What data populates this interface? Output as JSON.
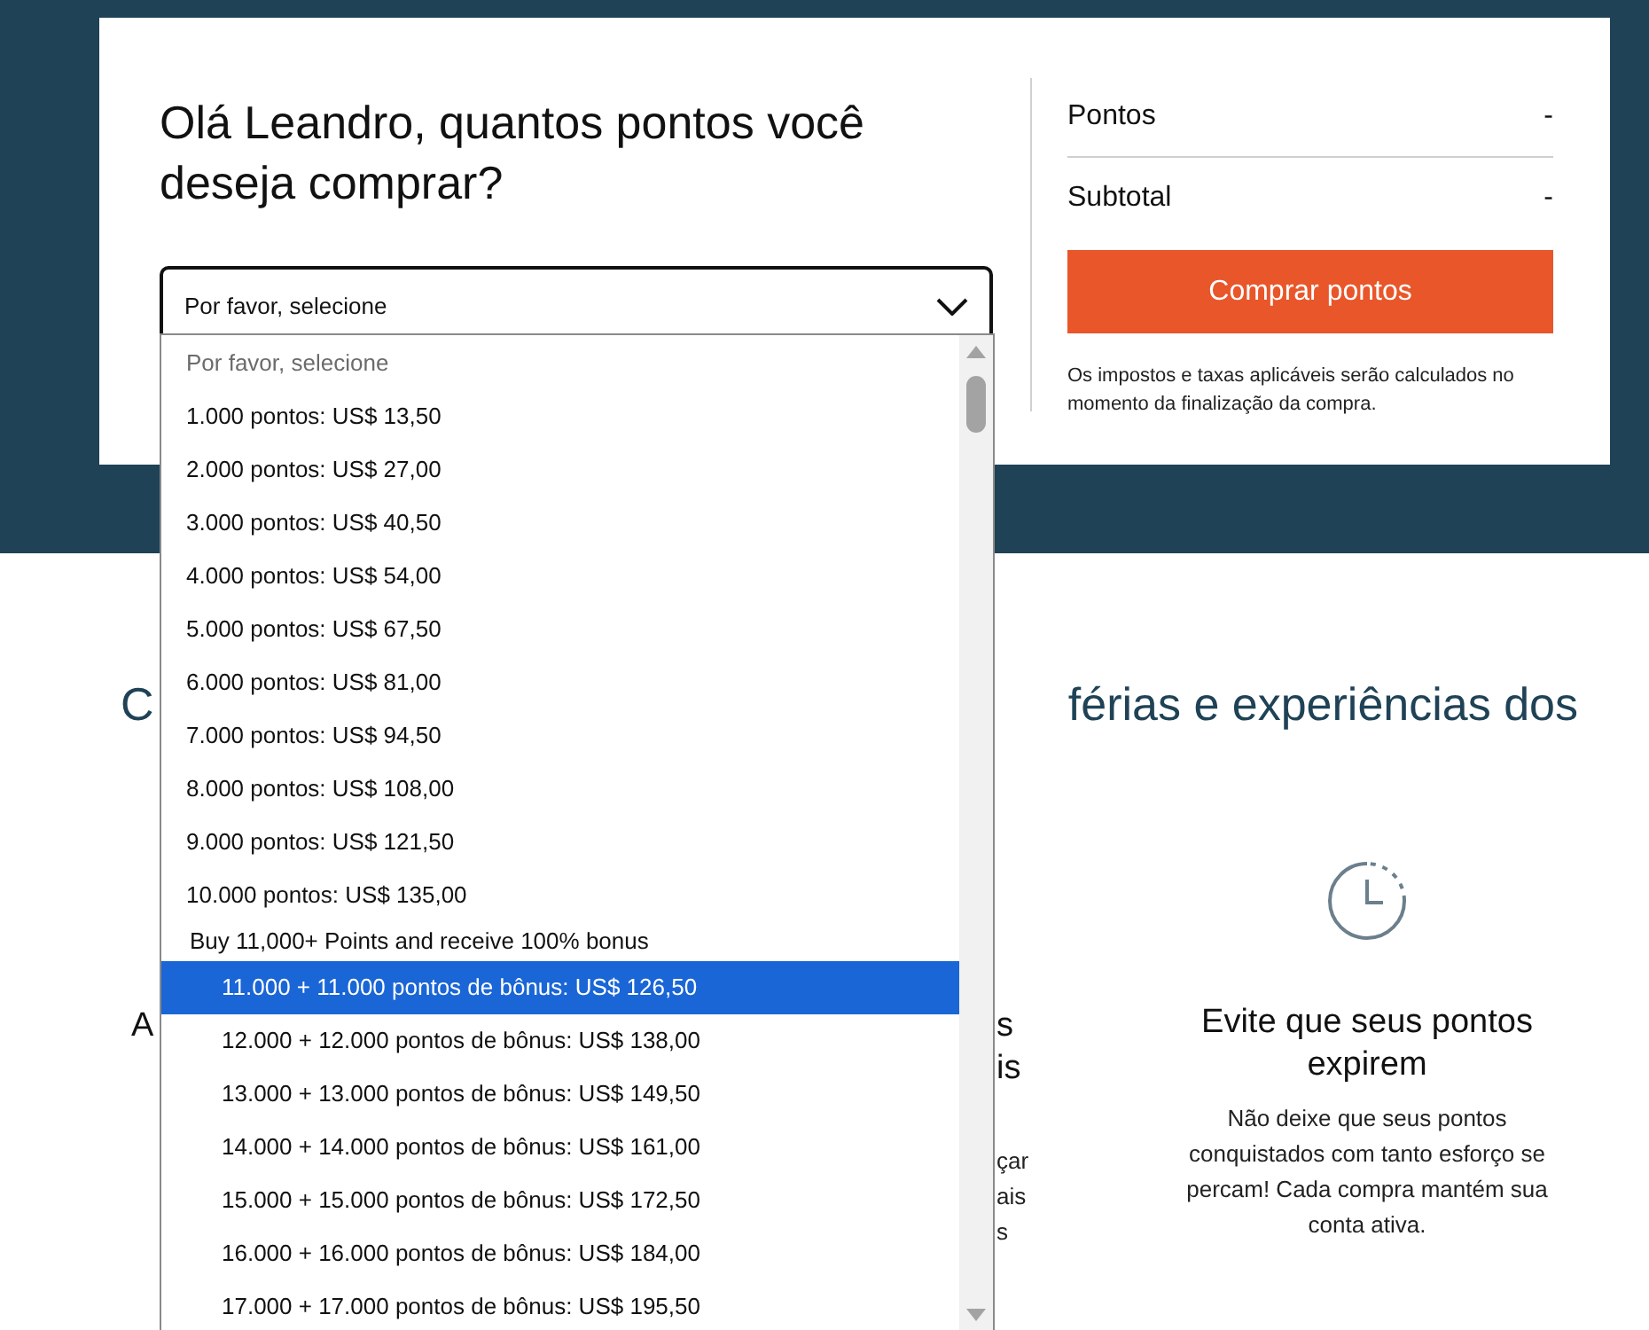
{
  "greeting": "Olá Leandro, quantos pontos você deseja comprar?",
  "select": {
    "value": "Por favor, selecione",
    "expanded": true
  },
  "dropdown": [
    {
      "kind": "placeholder",
      "label": "Por favor, selecione",
      "selected": false
    },
    {
      "kind": "option",
      "label": "1.000 pontos: US$ 13,50",
      "selected": false
    },
    {
      "kind": "option",
      "label": "2.000 pontos: US$ 27,00",
      "selected": false
    },
    {
      "kind": "option",
      "label": "3.000 pontos: US$ 40,50",
      "selected": false
    },
    {
      "kind": "option",
      "label": "4.000 pontos: US$ 54,00",
      "selected": false
    },
    {
      "kind": "option",
      "label": "5.000 pontos: US$ 67,50",
      "selected": false
    },
    {
      "kind": "option",
      "label": "6.000 pontos: US$ 81,00",
      "selected": false
    },
    {
      "kind": "option",
      "label": "7.000 pontos: US$ 94,50",
      "selected": false
    },
    {
      "kind": "option",
      "label": "8.000 pontos: US$ 108,00",
      "selected": false
    },
    {
      "kind": "option",
      "label": "9.000 pontos: US$ 121,50",
      "selected": false
    },
    {
      "kind": "option",
      "label": "10.000 pontos: US$ 135,00",
      "selected": false
    },
    {
      "kind": "group",
      "label": "Buy 11,000+ Points and receive 100% bonus",
      "children": [
        {
          "label": "11.000 + 11.000 pontos de bônus: US$ 126,50",
          "selected": true
        },
        {
          "label": "12.000 + 12.000 pontos de bônus: US$ 138,00",
          "selected": false
        },
        {
          "label": "13.000 + 13.000 pontos de bônus: US$ 149,50",
          "selected": false
        },
        {
          "label": "14.000 + 14.000 pontos de bônus: US$ 161,00",
          "selected": false
        },
        {
          "label": "15.000 + 15.000 pontos de bônus: US$ 172,50",
          "selected": false
        },
        {
          "label": "16.000 + 16.000 pontos de bônus: US$ 184,00",
          "selected": false
        },
        {
          "label": "17.000 + 17.000 pontos de bônus: US$ 195,50",
          "selected": false
        }
      ]
    }
  ],
  "summary": [
    {
      "label": "Pontos",
      "value": "-"
    },
    {
      "label": "Subtotal",
      "value": "-"
    }
  ],
  "buy_button": "Comprar pontos",
  "tax_note": "Os impostos e taxas aplicáveis serão calculados no momento da finalização da compra.",
  "section_heading": [
    "C",
    "férias e experiências dos"
  ],
  "features": [
    {
      "kind": "clipped_left",
      "title": [
        "A"
      ]
    },
    {
      "kind": "clipped_right",
      "title": [
        "s",
        "is"
      ],
      "body": [
        "çar",
        "ais",
        "s"
      ]
    },
    {
      "kind": "full",
      "title": [
        "Evite que seus pontos expirem"
      ],
      "body": [
        "Não deixe que seus pontos conquistados com tanto esforço se percam! Cada compra mantém sua conta ativa."
      ]
    }
  ]
}
